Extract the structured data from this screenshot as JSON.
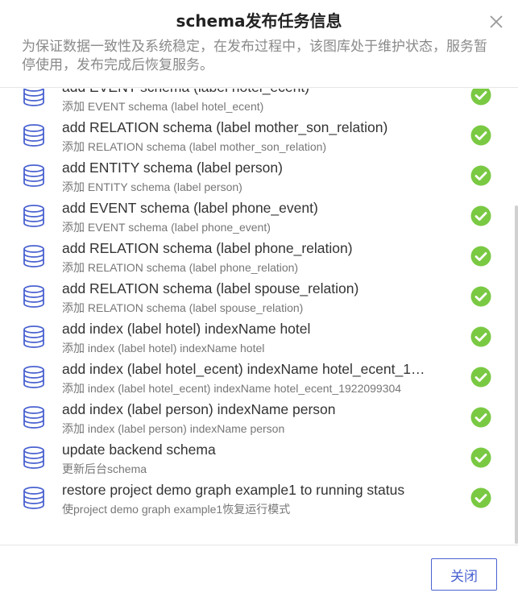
{
  "dialog": {
    "title": "schema发布任务信息",
    "notice": "为保证数据一致性及系统稳定，在发布过程中，该图库处于维护状态，服务暂停使用，发布完成后恢复服务。",
    "close_label": "关闭"
  },
  "colors": {
    "accent": "#4a62d0",
    "success": "#7ac943",
    "icon": "#4a62d0"
  },
  "tasks": [
    {
      "title": "add EVENT schema (label hotel_ecent)",
      "subtitle": "添加 EVENT schema (label hotel_ecent)",
      "status": "success"
    },
    {
      "title": "add RELATION schema (label mother_son_relation)",
      "subtitle": "添加 RELATION schema (label mother_son_relation)",
      "status": "success"
    },
    {
      "title": "add ENTITY schema (label person)",
      "subtitle": "添加 ENTITY schema (label person)",
      "status": "success"
    },
    {
      "title": "add EVENT schema (label phone_event)",
      "subtitle": "添加 EVENT schema (label phone_event)",
      "status": "success"
    },
    {
      "title": "add RELATION schema (label phone_relation)",
      "subtitle": "添加 RELATION schema (label phone_relation)",
      "status": "success"
    },
    {
      "title": "add RELATION schema (label spouse_relation)",
      "subtitle": "添加 RELATION schema (label spouse_relation)",
      "status": "success"
    },
    {
      "title": "add index (label hotel) indexName hotel",
      "subtitle": "添加 index (label hotel) indexName hotel",
      "status": "success"
    },
    {
      "title": "add index (label hotel_ecent) indexName hotel_ecent_19…",
      "subtitle": "添加 index (label hotel_ecent) indexName hotel_ecent_1922099304",
      "status": "success"
    },
    {
      "title": "add index (label person) indexName person",
      "subtitle": "添加 index (label person) indexName person",
      "status": "success"
    },
    {
      "title": "update backend schema",
      "subtitle": "更新后台schema",
      "status": "success"
    },
    {
      "title": "restore project demo graph example1 to running status",
      "subtitle": "使project demo graph example1恢复运行模式",
      "status": "success"
    }
  ]
}
